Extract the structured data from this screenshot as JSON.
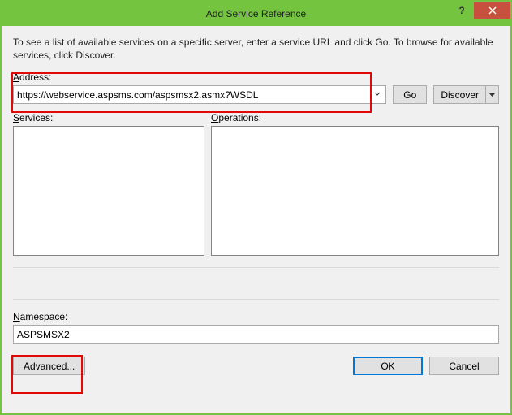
{
  "title": "Add Service Reference",
  "instructions": "To see a list of available services on a specific server, enter a service URL and click Go. To browse for available services, click Discover.",
  "address_label_pre": "A",
  "address_label_post": "ddress:",
  "address_value": "https://webservice.aspsms.com/aspsmsx2.asmx?WSDL",
  "go_label": "Go",
  "discover_label_pre": "D",
  "discover_label_post": "iscover",
  "services_label_pre": "S",
  "services_label_post": "ervices:",
  "operations_label_pre": "O",
  "operations_label_post": "perations:",
  "namespace_label_pre": "N",
  "namespace_label_post": "amespace:",
  "namespace_value": "ASPSMSX2",
  "advanced_label": "Advanced...",
  "ok_label": "OK",
  "cancel_label": "Cancel"
}
